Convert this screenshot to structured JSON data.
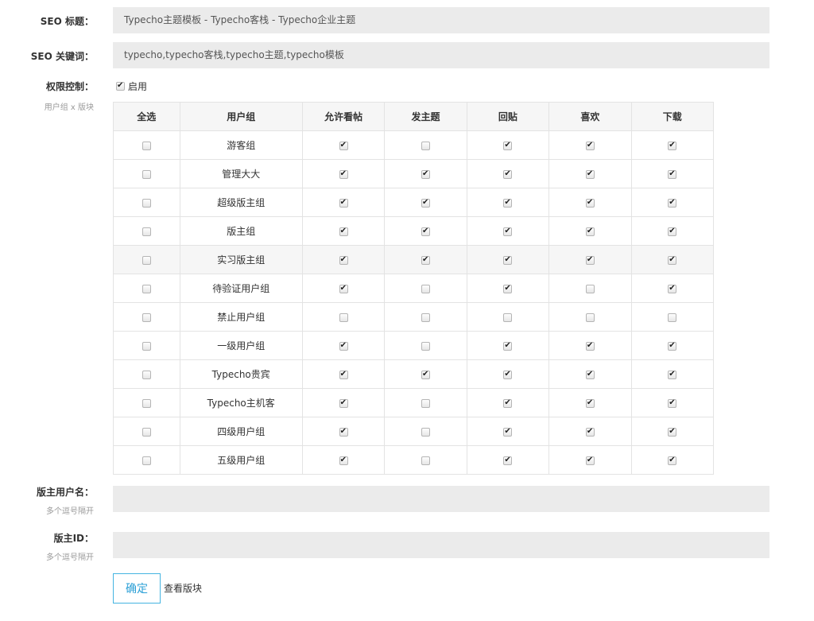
{
  "seo_title": {
    "label": "SEO 标题：",
    "value": "Typecho主题模板 - Typecho客栈 - Typecho企业主题"
  },
  "seo_keywords": {
    "label": "SEO 关键词：",
    "value": "typecho,typecho客栈,typecho主题,typecho模板"
  },
  "permission": {
    "label": "权限控制：",
    "sublabel": "用户组 x 版块",
    "enable_label": "启用",
    "enable_checked": true,
    "columns": [
      "全选",
      "用户组",
      "允许看帖",
      "发主题",
      "回贴",
      "喜欢",
      "下载"
    ],
    "rows": [
      {
        "group": "游客组",
        "all": false,
        "view": true,
        "post": false,
        "reply": true,
        "like": true,
        "download": true
      },
      {
        "group": "管理大大",
        "all": false,
        "view": true,
        "post": true,
        "reply": true,
        "like": true,
        "download": true
      },
      {
        "group": "超级版主组",
        "all": false,
        "view": true,
        "post": true,
        "reply": true,
        "like": true,
        "download": true
      },
      {
        "group": "版主组",
        "all": false,
        "view": true,
        "post": true,
        "reply": true,
        "like": true,
        "download": true
      },
      {
        "group": "实习版主组",
        "all": false,
        "view": true,
        "post": true,
        "reply": true,
        "like": true,
        "download": true
      },
      {
        "group": "待验证用户组",
        "all": false,
        "view": true,
        "post": false,
        "reply": true,
        "like": false,
        "download": true
      },
      {
        "group": "禁止用户组",
        "all": false,
        "view": false,
        "post": false,
        "reply": false,
        "like": false,
        "download": false
      },
      {
        "group": "一级用户组",
        "all": false,
        "view": true,
        "post": false,
        "reply": true,
        "like": true,
        "download": true
      },
      {
        "group": "Typecho贵宾",
        "all": false,
        "view": true,
        "post": true,
        "reply": true,
        "like": true,
        "download": true
      },
      {
        "group": "Typecho主机客",
        "all": false,
        "view": true,
        "post": false,
        "reply": true,
        "like": true,
        "download": true
      },
      {
        "group": "四级用户组",
        "all": false,
        "view": true,
        "post": false,
        "reply": true,
        "like": true,
        "download": true
      },
      {
        "group": "五级用户组",
        "all": false,
        "view": true,
        "post": false,
        "reply": true,
        "like": true,
        "download": true
      }
    ]
  },
  "moderator_names": {
    "label": "版主用户名：",
    "sublabel": "多个逗号隔开",
    "value": ""
  },
  "moderator_ids": {
    "label": "版主ID：",
    "sublabel": "多个逗号隔开",
    "value": ""
  },
  "actions": {
    "submit_label": "确定",
    "view_link": "查看版块"
  },
  "colors": {
    "accent": "#2a9fd6",
    "field_bg": "#ebebeb",
    "header_bg": "#f6f6f6"
  }
}
